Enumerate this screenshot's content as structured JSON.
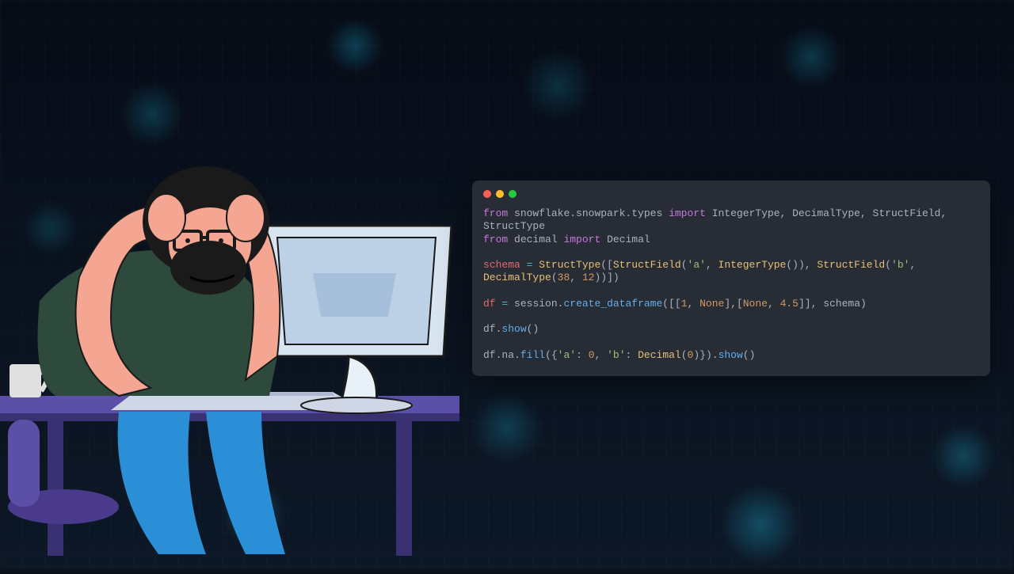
{
  "code": {
    "line1_from": "from",
    "line1_module": "snowflake.snowpark.types",
    "line1_import": "import",
    "line1_names": "IntegerType, DecimalType, StructField, StructType",
    "line2_from": "from",
    "line2_module": "decimal",
    "line2_import": "import",
    "line2_names": "Decimal",
    "line3_lhs": "schema",
    "line3_eq": "=",
    "line3_StructType": "StructType",
    "line3_StructField1": "StructField",
    "line3_sa": "'a'",
    "line3_IntegerType": "IntegerType",
    "line3_StructField2": "StructField",
    "line3_sb": "'b'",
    "line3_DecimalType": "DecimalType",
    "line3_38": "38",
    "line3_12": "12",
    "line4_lhs": "df",
    "line4_eq": "=",
    "line4_session": "session",
    "line4_create": "create_dataframe",
    "line4_1": "1",
    "line4_None1": "None",
    "line4_None2": "None",
    "line4_45": "4.5",
    "line4_schema": "schema",
    "line5_df": "df",
    "line5_show": "show",
    "line6_df": "df",
    "line6_na": "na",
    "line6_fill": "fill",
    "line6_ka": "'a'",
    "line6_0": "0",
    "line6_kb": "'b'",
    "line6_Decimal": "Decimal",
    "line6_d0": "0",
    "line6_show": "show"
  }
}
